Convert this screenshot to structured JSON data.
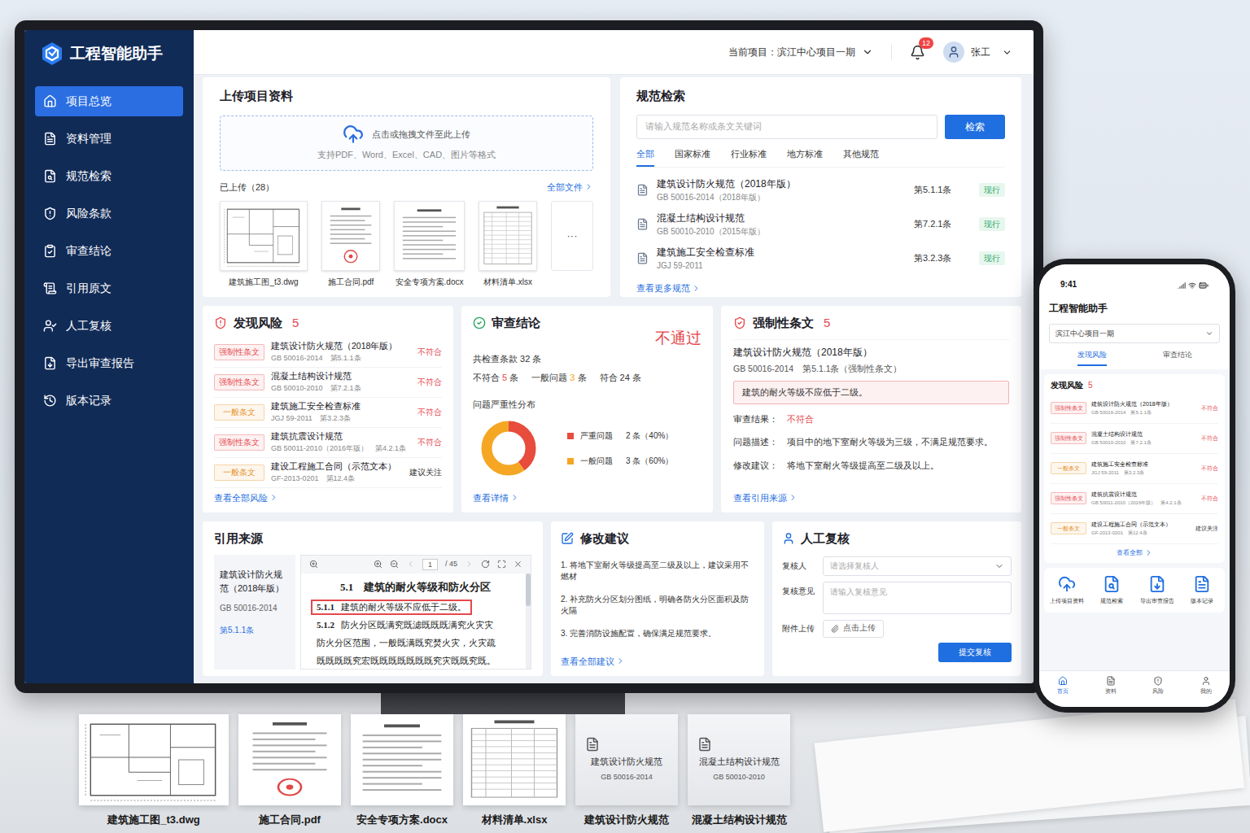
{
  "app": {
    "title": "工程智能助手"
  },
  "topbar": {
    "project_label": "当前项目：滨江中心项目一期",
    "notifications": "12",
    "user": "张工"
  },
  "sidebar": {
    "items": [
      {
        "label": "项目总览",
        "selected": true
      },
      {
        "label": "资料管理",
        "selected": false
      },
      {
        "label": "规范检索",
        "selected": false
      },
      {
        "label": "风险条款",
        "selected": false
      },
      {
        "label": "审查结论",
        "selected": false
      },
      {
        "label": "引用原文",
        "selected": false
      },
      {
        "label": "人工复核",
        "selected": false
      },
      {
        "label": "导出审查报告",
        "selected": false
      },
      {
        "label": "版本记录",
        "selected": false
      }
    ]
  },
  "upload": {
    "title": "上传项目资料",
    "drop_text": "点击或拖拽文件至此上传",
    "formats": "支持PDF、Word、Excel、CAD、图片等格式",
    "uploaded": "已上传（28）",
    "all_files": "全部文件",
    "files": [
      {
        "name": "建筑施工图_t3.dwg",
        "kind": "drawing"
      },
      {
        "name": "施工合同.pdf",
        "kind": "contract"
      },
      {
        "name": "安全专项方案.docx",
        "kind": "doc"
      },
      {
        "name": "材料清单.xlsx",
        "kind": "sheet"
      }
    ],
    "more": "···"
  },
  "search": {
    "title": "规范检索",
    "placeholder": "请输入规范名称或条文关键词",
    "button": "检索",
    "tabs": [
      {
        "label": "全部",
        "selected": true
      },
      {
        "label": "国家标准",
        "selected": false
      },
      {
        "label": "行业标准",
        "selected": false
      },
      {
        "label": "地方标准",
        "selected": false
      },
      {
        "label": "其他规范",
        "selected": false
      }
    ],
    "results": [
      {
        "name": "建筑设计防火规范（2018年版）",
        "code": "GB 50016-2014（2018年版）",
        "clause": "第5.1.1条",
        "status": "现行"
      },
      {
        "name": "混凝土结构设计规范",
        "code": "GB 50010-2010（2015年版）",
        "clause": "第7.2.1条",
        "status": "现行"
      },
      {
        "name": "建筑施工安全检查标准",
        "code": "JGJ 59-2011",
        "clause": "第3.2.3条",
        "status": "现行"
      }
    ],
    "more": "查看更多规范"
  },
  "risks": {
    "title": "发现风险",
    "count": "5",
    "more": "查看全部风险",
    "items": [
      {
        "tag": "强制性条文",
        "tag_color": "#e5484d",
        "name": "建筑设计防火规范（2018年版）",
        "code": "GB 50016-2014",
        "clause": "第5.1.1条",
        "status": "不符合",
        "status_color": "#e5484d"
      },
      {
        "tag": "强制性条文",
        "tag_color": "#e5484d",
        "name": "混凝土结构设计规范",
        "code": "GB 50010-2010",
        "clause": "第7.2.1条",
        "status": "不符合",
        "status_color": "#e5484d"
      },
      {
        "tag": "一般条文",
        "tag_color": "#e8901e",
        "name": "建筑施工安全检查标准",
        "code": "JGJ 59-2011",
        "clause": "第3.2.3条",
        "status": "不符合",
        "status_color": "#e5484d"
      },
      {
        "tag": "强制性条文",
        "tag_color": "#e5484d",
        "name": "建筑抗震设计规范",
        "code": "GB 50011-2010（2016年版）",
        "clause": "第4.2.1条",
        "status": "不符合",
        "status_color": "#e5484d"
      },
      {
        "tag": "一般条文",
        "tag_color": "#e8901e",
        "name": "建设工程施工合同（示范文本）",
        "code": "GF-2013-0201",
        "clause": "第12.4条",
        "status": "建议关注",
        "status_color": "#333333"
      }
    ]
  },
  "conclusion": {
    "title": "审查结论",
    "verdict": "不通过",
    "total": "共检查条款 32 条",
    "stats": [
      {
        "label": "不符合",
        "value": "5",
        "unit": "条",
        "color": "#e5484d"
      },
      {
        "label": "一般问题",
        "value": "3",
        "unit": "条",
        "color": "#f5a623"
      },
      {
        "label": "符合",
        "value": "24",
        "unit": "条",
        "color": "#333333"
      }
    ],
    "chart": {
      "title": "问题严重性分布",
      "series": [
        {
          "name": "严重问题",
          "value": 2,
          "reading": "2 条（40%）",
          "color": "#e74c3c"
        },
        {
          "name": "一般问题",
          "value": 3,
          "reading": "3 条（60%）",
          "color": "#f5a623"
        }
      ]
    },
    "more": "查看详情"
  },
  "mandatory": {
    "title": "强制性条文",
    "count": "5",
    "standard": "建筑设计防火规范（2018年版）",
    "ref": "GB 50016-2014　第5.1.1条（强制性条文）",
    "clause_text": "建筑的耐火等级不应低于二级。",
    "fields": [
      {
        "label": "审查结果：",
        "value": "不符合",
        "color": "#e5484d"
      },
      {
        "label": "问题描述：",
        "value": "项目中的地下室耐火等级为三级，不满足规范要求。",
        "color": "#333333"
      },
      {
        "label": "修改建议：",
        "value": "将地下室耐火等级提高至二级及以上。",
        "color": "#333333"
      }
    ],
    "more": "查看引用来源"
  },
  "citation": {
    "title": "引用来源",
    "standard": "建筑设计防火规范（2018年版）",
    "code": "GB 50016-2014",
    "clause": "第5.1.1条",
    "viewer": {
      "page": "1",
      "pages": "/ 45",
      "heading": "5.1　建筑的耐火等级和防火分区",
      "lines": [
        {
          "num": "5.1.1",
          "text": "建筑的耐火等级不应低于二级。",
          "highlighted": true
        },
        {
          "num": "5.1.2",
          "text": "防火分区既满究既滤既既既满究火灾灾",
          "highlighted": false
        },
        {
          "num": "",
          "text": "防火分区范围，一般既满既究焚火灾，火灾疏",
          "highlighted": false
        },
        {
          "num": "",
          "text": "既既既既究宏既既既既既既既究灾既既究既。",
          "highlighted": false
        }
      ]
    }
  },
  "suggestions": {
    "title": "修改建议",
    "items": [
      "1. 将地下室耐火等级提高至二级及以上，建议采用不燃材",
      "2. 补充防火分区划分图纸，明确各防火分区面积及防火隔",
      "3. 完善消防设施配置，确保满足规范要求。"
    ],
    "more": "查看全部建议"
  },
  "review": {
    "title": "人工复核",
    "reviewer_label": "复核人",
    "reviewer_placeholder": "请选择复核人",
    "comment_label": "复核意见",
    "comment_placeholder": "请输入复核意见",
    "attach_label": "附件上传",
    "attach_button": "点击上传",
    "submit": "提交复核"
  },
  "phone": {
    "time": "9:41",
    "title": "工程智能助手",
    "project": "滨江中心项目一期",
    "tabs": [
      {
        "label": "发现风险",
        "selected": true
      },
      {
        "label": "审查结论",
        "selected": false
      }
    ],
    "list_title": "发现风险",
    "list_count": "5",
    "more": "查看全部",
    "actions": [
      "上传项目资料",
      "规范检索",
      "导出审查报告",
      "版本记录"
    ],
    "nav": [
      {
        "label": "首页",
        "selected": true
      },
      {
        "label": "资料",
        "selected": false
      },
      {
        "label": "风险",
        "selected": false
      },
      {
        "label": "我的",
        "selected": false
      }
    ]
  },
  "bottom_docs": [
    {
      "label": "建筑施工图_t3.dwg",
      "kind": "drawing",
      "title": "",
      "code": ""
    },
    {
      "label": "施工合同.pdf",
      "kind": "contract",
      "title": "",
      "code": ""
    },
    {
      "label": "安全专项方案.docx",
      "kind": "doc",
      "title": "",
      "code": ""
    },
    {
      "label": "材料清单.xlsx",
      "kind": "sheet",
      "title": "",
      "code": ""
    },
    {
      "label": "建筑设计防火规范",
      "kind": "standard",
      "title": "建筑设计防火规范",
      "code": "GB 50016-2014"
    },
    {
      "label": "混凝土结构设计规范",
      "kind": "standard",
      "title": "混凝土结构设计规范",
      "code": "GB 50010-2010"
    }
  ]
}
